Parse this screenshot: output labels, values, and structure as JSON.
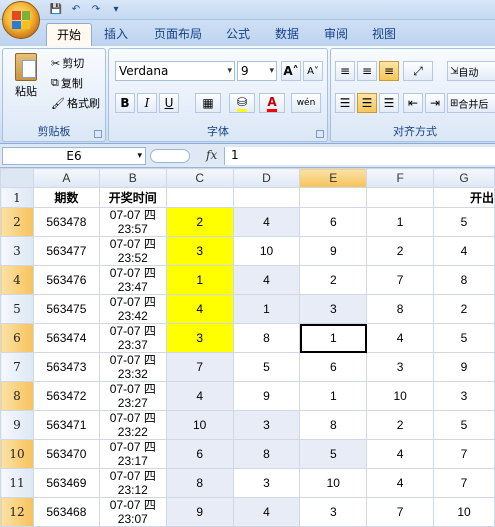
{
  "quick_access": {
    "save": "💾",
    "undo": "↶",
    "redo": "↷",
    "more": "▾"
  },
  "tabs": [
    "开始",
    "插入",
    "页面布局",
    "公式",
    "数据",
    "审阅",
    "视图"
  ],
  "clipboard": {
    "paste": "粘贴",
    "cut": "剪切",
    "copy": "复制",
    "format_painter": "格式刷",
    "label": "剪贴板"
  },
  "font": {
    "name": "Verdana",
    "size": "9",
    "grow": "A",
    "shrink": "A",
    "bold": "B",
    "italic": "I",
    "underline": "U",
    "label": "字体",
    "wen": "wén"
  },
  "alignment": {
    "wrap": "自动",
    "merge": "合并后",
    "label": "对齐方式"
  },
  "formula_bar": {
    "name_box": "E6",
    "fx": "fx",
    "value": "1"
  },
  "columns": [
    "A",
    "B",
    "C",
    "D",
    "E",
    "F",
    "G"
  ],
  "header_row": {
    "row": "1",
    "a": "期数",
    "b": "开奖时间",
    "g": "开出"
  },
  "rows": [
    {
      "row": "2",
      "a": "563478",
      "b1": "07-07 四",
      "b2": "23:57",
      "c": "2",
      "d": "4",
      "e": "6",
      "f": "1",
      "g": "5"
    },
    {
      "row": "3",
      "a": "563477",
      "b1": "07-07 四",
      "b2": "23:52",
      "c": "3",
      "d": "10",
      "e": "9",
      "f": "2",
      "g": "4"
    },
    {
      "row": "4",
      "a": "563476",
      "b1": "07-07 四",
      "b2": "23:47",
      "c": "1",
      "d": "4",
      "e": "2",
      "f": "7",
      "g": "8"
    },
    {
      "row": "5",
      "a": "563475",
      "b1": "07-07 四",
      "b2": "23:42",
      "c": "4",
      "d": "1",
      "e": "3",
      "f": "8",
      "g": "2"
    },
    {
      "row": "6",
      "a": "563474",
      "b1": "07-07 四",
      "b2": "23:37",
      "c": "3",
      "d": "8",
      "e": "1",
      "f": "4",
      "g": "5"
    },
    {
      "row": "7",
      "a": "563473",
      "b1": "07-07 四",
      "b2": "23:32",
      "c": "7",
      "d": "5",
      "e": "6",
      "f": "3",
      "g": "9"
    },
    {
      "row": "8",
      "a": "563472",
      "b1": "07-07 四",
      "b2": "23:27",
      "c": "4",
      "d": "9",
      "e": "1",
      "f": "10",
      "g": "3"
    },
    {
      "row": "9",
      "a": "563471",
      "b1": "07-07 四",
      "b2": "23:22",
      "c": "10",
      "d": "3",
      "e": "8",
      "f": "2",
      "g": "5"
    },
    {
      "row": "10",
      "a": "563470",
      "b1": "07-07 四",
      "b2": "23:17",
      "c": "6",
      "d": "8",
      "e": "5",
      "f": "4",
      "g": "7"
    },
    {
      "row": "11",
      "a": "563469",
      "b1": "07-07 四",
      "b2": "23:12",
      "c": "8",
      "d": "3",
      "e": "10",
      "f": "4",
      "g": "7"
    },
    {
      "row": "12",
      "a": "563468",
      "b1": "07-07 四",
      "b2": "23:07",
      "c": "9",
      "d": "4",
      "e": "3",
      "f": "7",
      "g": "10"
    }
  ],
  "colors": {
    "highlight": "#ffff00",
    "selection": "#f7c25a",
    "ribbon": "#dae6f6"
  }
}
